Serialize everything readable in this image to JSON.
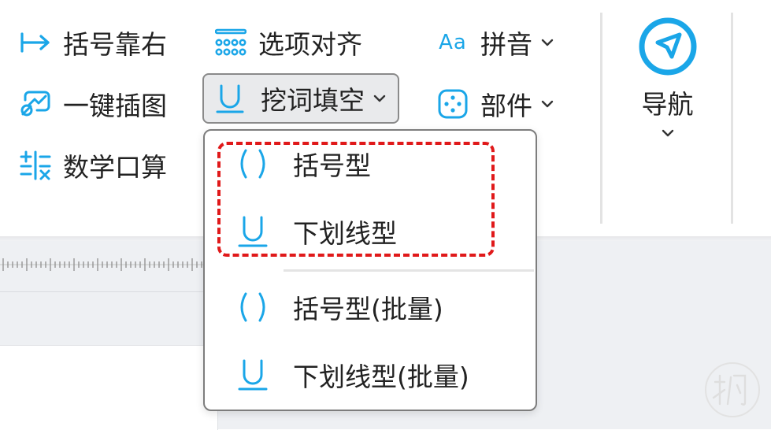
{
  "ribbon": {
    "bracket_right": "括号靠右",
    "insert_image": "一键插图",
    "math_oral": "数学口算",
    "option_align": "选项对齐",
    "fill_blank": "挖词填空",
    "pinyin": "拼音",
    "components": "部件",
    "navigation": "导航"
  },
  "dropdown": {
    "items": [
      {
        "label": "括号型",
        "icon": "parentheses-icon"
      },
      {
        "label": "下划线型",
        "icon": "underline-icon"
      },
      {
        "label": "括号型(批量)",
        "icon": "parentheses-icon"
      },
      {
        "label": "下划线型(批量)",
        "icon": "underline-icon"
      }
    ]
  },
  "icons": {
    "pinyin_glyph": "Aa"
  },
  "colors": {
    "accent": "#1aa6e8",
    "highlight": "#e0191a",
    "active_bg": "#e9eaec"
  }
}
